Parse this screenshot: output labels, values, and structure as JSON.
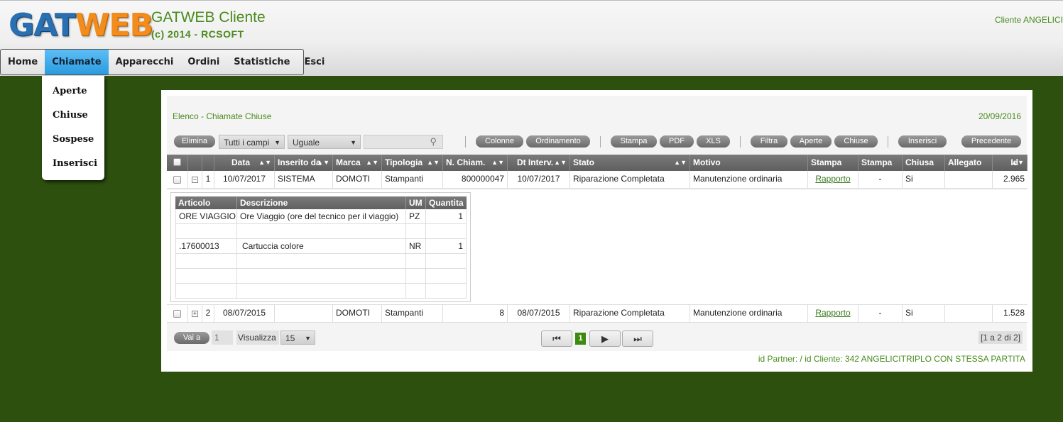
{
  "logo": {
    "part1": "GAT",
    "part2": "WEB"
  },
  "app": {
    "title": "GATWEB Cliente",
    "subtitle": "(c) 2014 - RCSOFT"
  },
  "client_label": "Cliente ANGELICI",
  "menu": {
    "items": [
      "Home",
      "Chiamate",
      "Apparecchi",
      "Ordini",
      "Statistiche",
      "Esci"
    ],
    "active": "Chiamate",
    "dropdown": [
      "Aperte",
      "Chiuse",
      "Sospese",
      "Inserisci"
    ]
  },
  "panel": {
    "title": "Elenco - Chiamate Chiuse",
    "date": "20/09/2016"
  },
  "toolbar": {
    "elimina": "Elimina",
    "field_select": "Tutti i campi",
    "operator_select": "Uguale",
    "search_value": "",
    "colonne": "Colonne",
    "ordinamento": "Ordinamento",
    "stampa": "Stampa",
    "pdf": "PDF",
    "xls": "XLS",
    "filtra": "Filtra",
    "aperte": "Aperte",
    "chiuse": "Chiuse",
    "inserisci": "Inserisci",
    "precedente": "Precedente"
  },
  "grid": {
    "headers": [
      "Data",
      "Inserito da",
      "Marca",
      "Tipologia",
      "N. Chiam.",
      "Dt Interv.",
      "Stato",
      "Motivo",
      "Stampa",
      "Stampa",
      "Chiusa",
      "Allegato",
      "Id"
    ],
    "rows": [
      {
        "toggle": "−",
        "num": "1",
        "data": "10/07/2017",
        "inserito": "SISTEMA",
        "marca": "DOMOTI",
        "tipologia": "Stampanti",
        "nchiam": "800000047",
        "dtinterv": "10/07/2017",
        "stato": "Riparazione Completata",
        "motivo": "Manutenzione ordinaria",
        "stampa1": "Rapporto",
        "stampa2": "-",
        "chiusa": "Si",
        "allegato": "",
        "id": "2.965"
      },
      {
        "toggle": "+",
        "num": "2",
        "data": "08/07/2015",
        "inserito": "",
        "marca": "DOMOTI",
        "tipologia": "Stampanti",
        "nchiam": "8",
        "dtinterv": "08/07/2015",
        "stato": "Riparazione Completata",
        "motivo": "Manutenzione ordinaria",
        "stampa1": "Rapporto",
        "stampa2": "-",
        "chiusa": "Si",
        "allegato": "",
        "id": "1.528"
      }
    ]
  },
  "detail": {
    "headers": [
      "Articolo",
      "Descrizione",
      "UM",
      "Quantita"
    ],
    "rows": [
      {
        "articolo": "ORE VIAGGIO",
        "descrizione": "Ore Viaggio (ore del tecnico per il viaggio)",
        "um": "PZ",
        "quantita": "1"
      },
      {
        "articolo": "",
        "descrizione": "",
        "um": "",
        "quantita": ""
      },
      {
        "articolo": ".17600013",
        "descrizione": "Cartuccia colore",
        "um": "NR",
        "quantita": "1"
      },
      {
        "articolo": "",
        "descrizione": "",
        "um": "",
        "quantita": ""
      },
      {
        "articolo": "",
        "descrizione": "",
        "um": "",
        "quantita": ""
      },
      {
        "articolo": "",
        "descrizione": "",
        "um": "",
        "quantita": ""
      }
    ]
  },
  "pager": {
    "vai_a": "Vai a",
    "page_input": "1",
    "visualizza": "Visualizza",
    "page_size": "15",
    "current_page": "1",
    "summary": "[1 a 2 di 2]"
  },
  "footer": "id Partner: / id Cliente: 342 ANGELICITRIPLO CON STESSA PARTITA",
  "colors": {
    "accent": "#4a8a1c",
    "background": "#2d500f",
    "menu_active": "#2a9be0"
  }
}
